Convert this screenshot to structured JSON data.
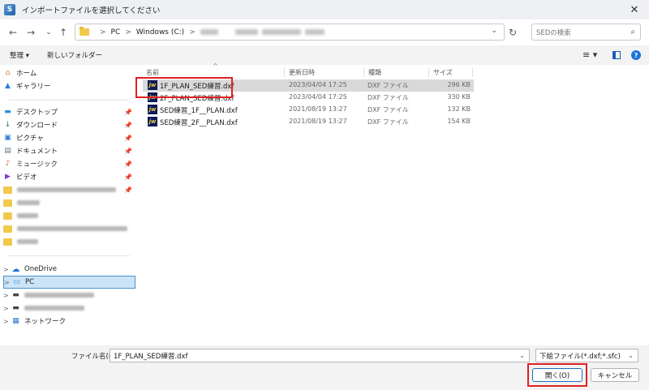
{
  "window": {
    "title": "インポートファイルを選択してください",
    "close_glyph": "✕",
    "app_icon_letter": "S"
  },
  "nav": {
    "back_icon": "←",
    "forward_icon": "→",
    "recent_icon": "⌄",
    "up_icon": "↑",
    "breadcrumbs": [
      "PC",
      "Windows (C:)"
    ],
    "refresh_icon": "↻",
    "search_placeholder": "SEDの検索",
    "search_icon": "⌕"
  },
  "toolbar": {
    "organize": "整理 ▾",
    "new_folder": "新しいフォルダー",
    "view_icon": "≡ ▾"
  },
  "sidebar": {
    "quick": [
      {
        "label": "ホーム",
        "icon": "home-icon",
        "glyph": "⌂",
        "color": "#d9822b"
      },
      {
        "label": "ギャラリー",
        "icon": "gallery-icon",
        "glyph": "▲",
        "color": "#2b7bd9"
      }
    ],
    "pinned": [
      {
        "label": "デスクトップ",
        "icon": "desktop-icon",
        "glyph": "▬",
        "color": "#2b8fd9"
      },
      {
        "label": "ダウンロード",
        "icon": "download-icon",
        "glyph": "↓",
        "color": "#1a8a4a"
      },
      {
        "label": "ピクチャ",
        "icon": "pictures-icon",
        "glyph": "▣",
        "color": "#2b7bd9"
      },
      {
        "label": "ドキュメント",
        "icon": "documents-icon",
        "glyph": "▤",
        "color": "#6a7a8a"
      },
      {
        "label": "ミュージック",
        "icon": "music-icon",
        "glyph": "♪",
        "color": "#e05a2a"
      },
      {
        "label": "ビデオ",
        "icon": "video-icon",
        "glyph": "▶",
        "color": "#8a3ad0"
      }
    ],
    "tree": [
      {
        "label": "OneDrive",
        "icon": "onedrive-icon"
      },
      {
        "label": "PC",
        "icon": "pc-icon"
      },
      {
        "label": "ネットワーク",
        "icon": "network-icon"
      }
    ]
  },
  "columns": {
    "name": "名前",
    "modified": "更新日時",
    "type": "種類",
    "size": "サイズ",
    "sort_caret": "^"
  },
  "files": [
    {
      "name": "1F_PLAN_SED練習.dxf",
      "modified": "2023/04/04 17:25",
      "type": "DXF ファイル",
      "size": "296 KB"
    },
    {
      "name": "2F_PLAN_SED練習.dxf",
      "modified": "2023/04/04 17:25",
      "type": "DXF ファイル",
      "size": "330 KB"
    },
    {
      "name": "SED練習_1F__PLAN.dxf",
      "modified": "2021/08/19 13:27",
      "type": "DXF ファイル",
      "size": "132 KB"
    },
    {
      "name": "SED練習_2F__PLAN.dxf",
      "modified": "2021/08/19 13:27",
      "type": "DXF ファイル",
      "size": "154 KB"
    }
  ],
  "file_icon_text": "jw",
  "footer": {
    "filename_label": "ファイル名(N):",
    "filename_value": "1F_PLAN_SED練習.dxf",
    "filetype_value": "下絵ファイル(*.dxf;*.sfc)",
    "open_button": "開く(O)",
    "cancel_button": "キャンセル",
    "chevron": "⌄"
  },
  "colors": {
    "highlight": "#e02020",
    "selection": "#cce4f7",
    "accent": "#1a6fc8"
  }
}
